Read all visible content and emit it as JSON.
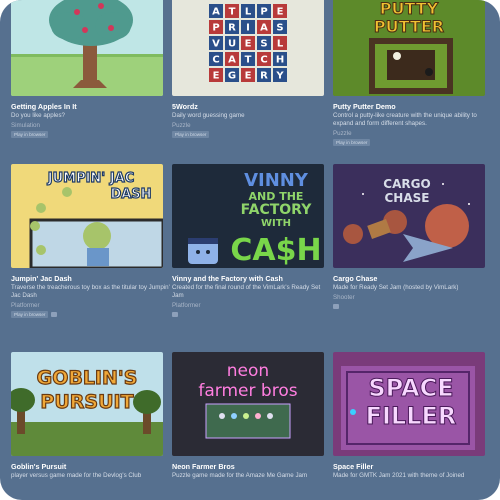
{
  "games": [
    {
      "title": "Getting Apples In It",
      "desc": "Do you like apples?",
      "genre": "Simulation",
      "badge": "Play in browser"
    },
    {
      "title": "5Wordz",
      "desc": "Daily word guessing game",
      "genre": "Puzzle",
      "badge": "Play in browser"
    },
    {
      "title": "Putty Putter Demo",
      "desc": "Control a putty-like creature with the unique ability to expand and form different shapes.",
      "genre": "Puzzle",
      "badge": "Play in browser"
    },
    {
      "title": "Jumpin' Jac Dash",
      "desc": "Traverse the treacherous toy box as the titular toy Jumpin' Jac Dash",
      "genre": "Platformer",
      "badge": "Play in browser"
    },
    {
      "title": "Vinny and the Factory with Cash",
      "desc": "Created for the final round of the VimLark's Ready Set Jam",
      "genre": "Platformer",
      "badge": ""
    },
    {
      "title": "Cargo Chase",
      "desc": "Made for Ready Set Jam (hosted by VimLark)",
      "genre": "Shooter",
      "badge": ""
    },
    {
      "title": "Goblin's Pursuit",
      "desc": "player versus game made for the Devlog's Club",
      "genre": "",
      "badge": ""
    },
    {
      "title": "Neon Farmer Bros",
      "desc": "Puzzle game made for the Amaze Me Game Jam",
      "genre": "",
      "badge": ""
    },
    {
      "title": "Space Filler",
      "desc": "Made for GMTK Jam 2021 with theme of Joined",
      "genre": "",
      "badge": ""
    }
  ],
  "thumb_text": {
    "wordz_rows": [
      "ATLPE",
      "PRIAS",
      "VUESL",
      "CATCH",
      "EGERY"
    ],
    "putty_line1": "PUTTY",
    "putty_line2": "PUTTER",
    "jumpin_line1": "JUMPIN' JAC",
    "jumpin_line2": "DASH",
    "vinny_line1": "VINNY",
    "vinny_line2": "AND THE",
    "vinny_line3": "FACTORY",
    "vinny_line4": "WITH",
    "vinny_line5": "CA$H",
    "cargo_line1": "CARGO",
    "cargo_line2": "CHASE",
    "goblin_line1": "GOBLIN'S",
    "goblin_line2": "PURSUIT",
    "neon_line1": "neon",
    "neon_line2": "farmer bros",
    "space_line1": "SPACE",
    "space_line2": "FILLER"
  },
  "colors": {
    "page_bg": "#56708f",
    "title": "#ffffff",
    "desc": "#d5dde8",
    "genre": "#a9b6c8"
  }
}
